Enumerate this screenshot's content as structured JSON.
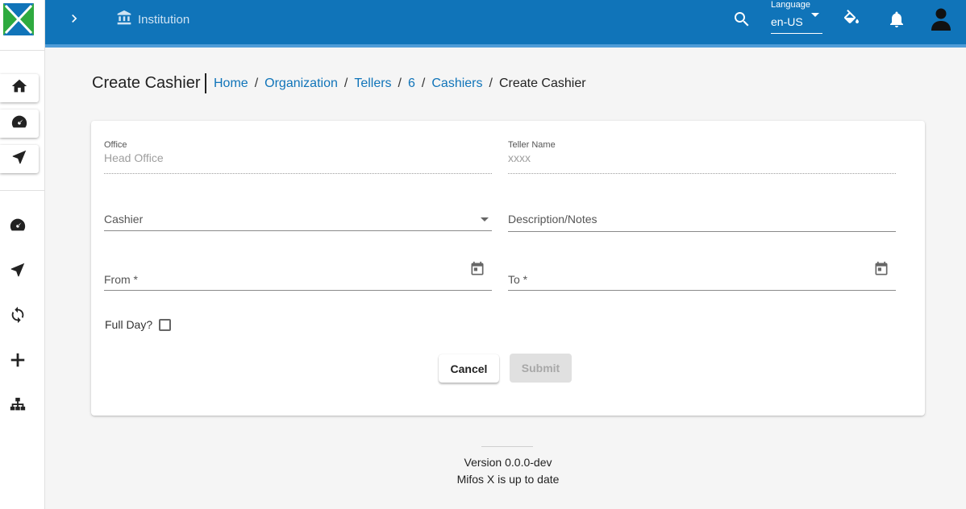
{
  "toolbar": {
    "institution_label": "Institution",
    "language_label": "Language",
    "language_value": "en-US"
  },
  "sidebar": {
    "items": [
      {
        "icon": "home-icon"
      },
      {
        "icon": "dashboard-icon"
      },
      {
        "icon": "navigation-icon"
      },
      {
        "icon": "dashboard-icon"
      },
      {
        "icon": "navigation-icon"
      },
      {
        "icon": "sync-icon"
      },
      {
        "icon": "plus-icon"
      },
      {
        "icon": "sitemap-icon"
      }
    ]
  },
  "page": {
    "title": "Create Cashier",
    "breadcrumb": [
      "Home",
      "Organization",
      "Tellers",
      "6",
      "Cashiers"
    ],
    "breadcrumb_current": "Create Cashier"
  },
  "form": {
    "office_label": "Office",
    "office_value": "Head Office",
    "teller_label": "Teller Name",
    "teller_value": "xxxx",
    "cashier_placeholder": "Cashier",
    "description_placeholder": "Description/Notes",
    "from_placeholder": "From *",
    "to_placeholder": "To *",
    "fullday_label": "Full Day?",
    "fullday_checked": false,
    "cancel_label": "Cancel",
    "submit_label": "Submit"
  },
  "footer": {
    "version": "Version 0.0.0-dev",
    "status": "Mifos X is up to date"
  },
  "colors": {
    "toolbar": "#1074b9",
    "link": "#1074b9"
  }
}
